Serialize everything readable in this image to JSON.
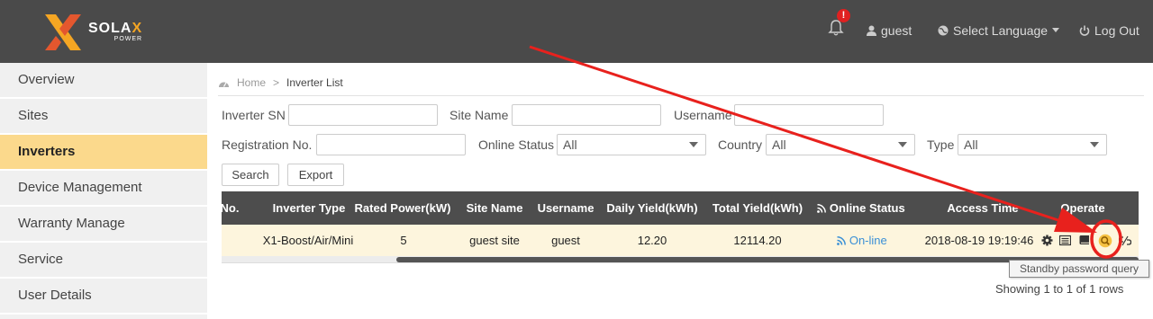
{
  "header": {
    "logo": {
      "brand_left": "SOLA",
      "brand_x": "X",
      "sub": "POWER"
    },
    "notification_count": "!",
    "user_label": "guest",
    "language_label": "Select Language",
    "logout_label": "Log Out"
  },
  "sidebar": {
    "items": [
      {
        "label": "Overview",
        "active": false
      },
      {
        "label": "Sites",
        "active": false
      },
      {
        "label": "Inverters",
        "active": true
      },
      {
        "label": "Device Management",
        "active": false
      },
      {
        "label": "Warranty Manage",
        "active": false
      },
      {
        "label": "Service",
        "active": false
      },
      {
        "label": "User Details",
        "active": false
      }
    ]
  },
  "breadcrumb": {
    "home": "Home",
    "separator": ">",
    "current": "Inverter List"
  },
  "filters": {
    "inverter_sn": {
      "label": "Inverter SN",
      "value": ""
    },
    "site_name": {
      "label": "Site Name",
      "value": ""
    },
    "username": {
      "label": "Username",
      "value": ""
    },
    "registration_no": {
      "label": "Registration No.",
      "value": ""
    },
    "online_status": {
      "label": "Online Status",
      "selected": "All"
    },
    "country": {
      "label": "Country",
      "selected": "All"
    },
    "type": {
      "label": "Type",
      "selected": "All"
    },
    "search_label": "Search",
    "export_label": "Export"
  },
  "table": {
    "columns": [
      "No.",
      "Inverter Type",
      "Rated Power(kW)",
      "Site Name",
      "Username",
      "Daily Yield(kWh)",
      "Total Yield(kWh)",
      "Online Status",
      "Access Time",
      "Operate"
    ],
    "rows": [
      {
        "inverter_type": "X1-Boost/Air/Mini",
        "rated_power": "5",
        "site_name": "guest site",
        "username": "guest",
        "daily_yield": "12.20",
        "total_yield": "12114.20",
        "online_status": "On-line",
        "access_time": "2018-08-19 19:19:46"
      }
    ],
    "operate_icons": [
      "gear-icon",
      "list-icon",
      "book-icon",
      "search-icon",
      "unlink-icon"
    ]
  },
  "tooltip": "Standby password query",
  "pagination": {
    "summary": "Showing 1 to 1 of 1 rows"
  },
  "colors": {
    "header_bg": "#4a4a4a",
    "sidebar_active": "#fbd98c",
    "table_header": "#4d4d4d",
    "row_bg": "#fdf5dd",
    "link": "#3a8fd6",
    "annotation_red": "#e8211d",
    "accent_orange": "#f5a623"
  }
}
